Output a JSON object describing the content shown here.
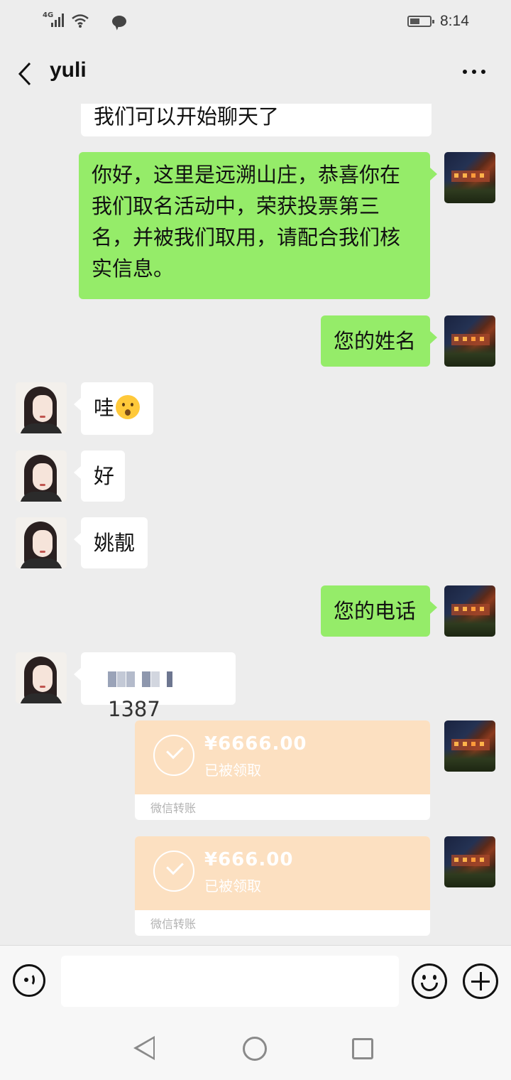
{
  "status_bar": {
    "network": "4G",
    "time": "8:14"
  },
  "header": {
    "title": "yuli"
  },
  "messages": {
    "m0": "我们可以开始聊天了",
    "m1": "你好，这里是远溯山庄，恭喜你在我们取名活动中，荣获投票第三名，并被我们取用，请配合我们核实信息。",
    "m2": "您的姓名",
    "m3": "哇",
    "m4": "好",
    "m5": "姚靓",
    "m6": "您的电话",
    "m7_suffix": "1387"
  },
  "transfers": [
    {
      "amount": "¥6666.00",
      "status": "已被领取",
      "label": "微信转账"
    },
    {
      "amount": "¥666.00",
      "status": "已被领取",
      "label": "微信转账"
    }
  ],
  "input": {
    "placeholder": ""
  },
  "colors": {
    "background": "#ededed",
    "my_bubble": "#95ec69",
    "their_bubble": "#ffffff",
    "transfer": "#fce0c1"
  }
}
